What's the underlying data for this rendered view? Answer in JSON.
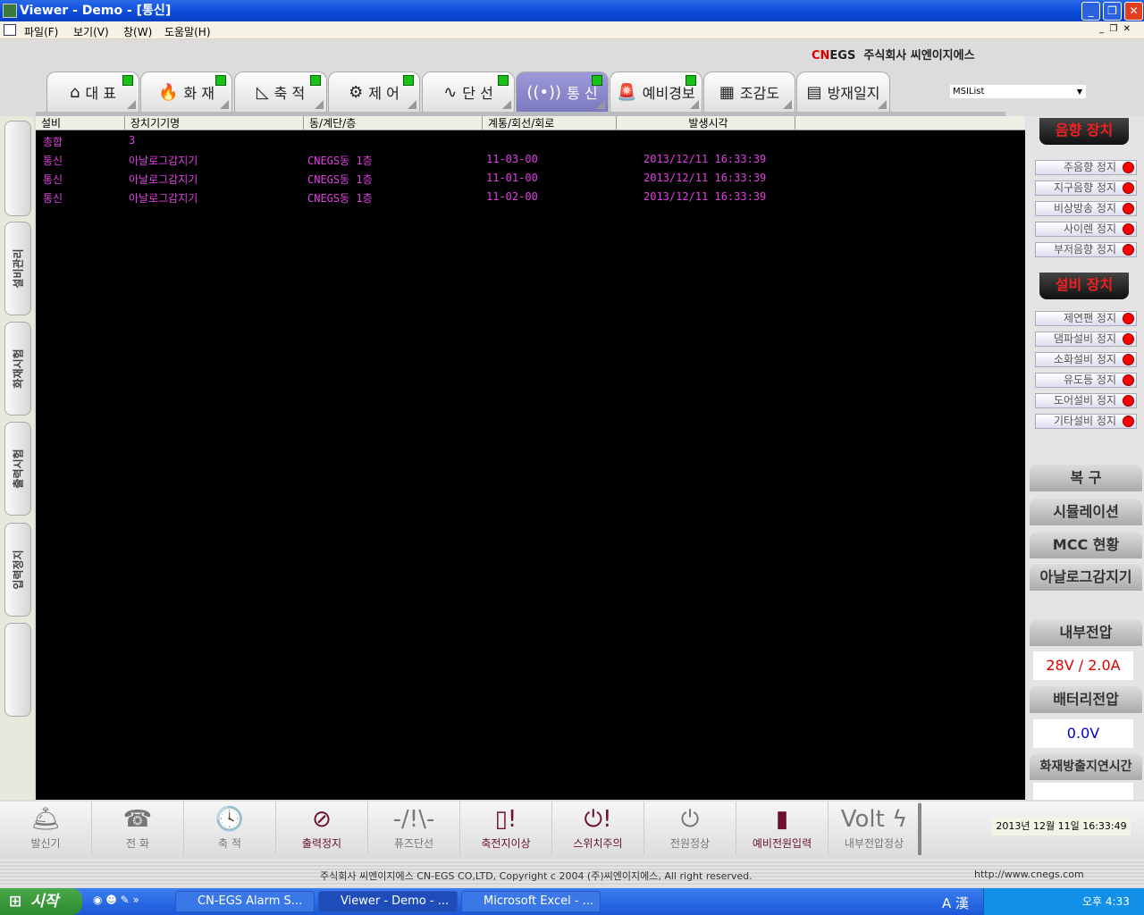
{
  "window": {
    "title": "Viewer - Demo - [통신]",
    "min": "_",
    "max": "❐",
    "close": "✕"
  },
  "menu": [
    "파일(F)",
    "보기(V)",
    "창(W)",
    "도움말(H)"
  ],
  "brand": {
    "logo_red": "CN",
    "logo_rest": "EGS",
    "name": "주식회사 씨엔이지에스"
  },
  "tabs": [
    {
      "label": "대 표",
      "icon": "⌂",
      "selected": false
    },
    {
      "label": "화 재",
      "icon": "🔥",
      "selected": false
    },
    {
      "label": "축 적",
      "icon": "◺",
      "selected": false
    },
    {
      "label": "제 어",
      "icon": "⚙",
      "selected": false
    },
    {
      "label": "단 선",
      "icon": "∿",
      "selected": false
    },
    {
      "label": "통 신",
      "icon": "((•))",
      "selected": true
    },
    {
      "label": "예비경보",
      "icon": "🚨",
      "selected": false
    },
    {
      "label": "조감도",
      "icon": "▦",
      "selected": false
    },
    {
      "label": "방재일지",
      "icon": "▤",
      "selected": false
    }
  ],
  "dropdown": {
    "value": "MSIList"
  },
  "grid": {
    "columns": [
      "설비",
      "장치기기명",
      "동/계단/층",
      "계통/회선/회로",
      "발생시각"
    ],
    "summary": {
      "label": "총합",
      "count": "3"
    },
    "rows": [
      [
        "통신",
        "아날로그감지기",
        "CNEGS동 1층",
        "11-03-00",
        "2013/12/11 16:33:39"
      ],
      [
        "통신",
        "아날로그감지기",
        "CNEGS동 1층",
        "11-01-00",
        "2013/12/11 16:33:39"
      ],
      [
        "통신",
        "아날로그감지기",
        "CNEGS동 1층",
        "11-02-00",
        "2013/12/11 16:33:39"
      ]
    ]
  },
  "side_tabs": [
    "",
    "설비관리",
    "화재시험",
    "출력시험",
    "입력정지",
    ""
  ],
  "right_panel": {
    "sound_header": "음향 장치",
    "sound_buttons": [
      "주음향 정지",
      "지구음향 정지",
      "비상방송 정지",
      "사이렌 정지",
      "부저음향 정지"
    ],
    "equip_header": "설비 장치",
    "equip_buttons": [
      "제연팬 정지",
      "댐파설비 정지",
      "소화설비 정지",
      "유도등 정지",
      "도어설비 정지",
      "기타설비 정지"
    ],
    "reset": "복   구",
    "simulation": "시뮬레이션",
    "mcc": "MCC 현황",
    "analog": "아날로그감지기",
    "internal_voltage_label": "내부전압",
    "internal_voltage_value": "28V / 2.0A",
    "battery_label": "배터리전압",
    "battery_value": "0.0V",
    "delay_label": "화재방출지연시간",
    "delay_value": "",
    "colors": {
      "internal": "#e00000",
      "battery": "#0000c0",
      "indicator": "#ff0000"
    }
  },
  "status_items": [
    {
      "label": "발신기",
      "icon": "🛎",
      "active": false
    },
    {
      "label": "전 화",
      "icon": "☎",
      "active": false
    },
    {
      "label": "축 적",
      "icon": "🕓",
      "active": false
    },
    {
      "label": "출력정지",
      "icon": "⊘",
      "active": true
    },
    {
      "label": "퓨즈단선",
      "icon": "-/!\\-",
      "active": false
    },
    {
      "label": "축전지이상",
      "icon": "▯!",
      "active": true
    },
    {
      "label": "스위치주의",
      "icon": "⏻!",
      "active": true
    },
    {
      "label": "전원정상",
      "icon": "⏻",
      "active": false
    },
    {
      "label": "예비전원입력",
      "icon": "▮",
      "active": true
    },
    {
      "label": "내부전압정상",
      "icon": "Volt ϟ",
      "active": false
    }
  ],
  "datetime": "2013년 12월 11일 16:33:49",
  "footer": {
    "copyright": "주식회사 씨엔이지에스 CN-EGS CO,LTD, Copyright c 2004 (주)씨엔이지에스, All right reserved.",
    "url": "http://www.cnegs.com"
  },
  "taskbar": {
    "start": "시작",
    "tasks": [
      "CN-EGS Alarm S...",
      "Viewer - Demo - ...",
      "Microsoft Excel - ..."
    ],
    "ime": "A 漢",
    "clock": "오후 4:33"
  }
}
